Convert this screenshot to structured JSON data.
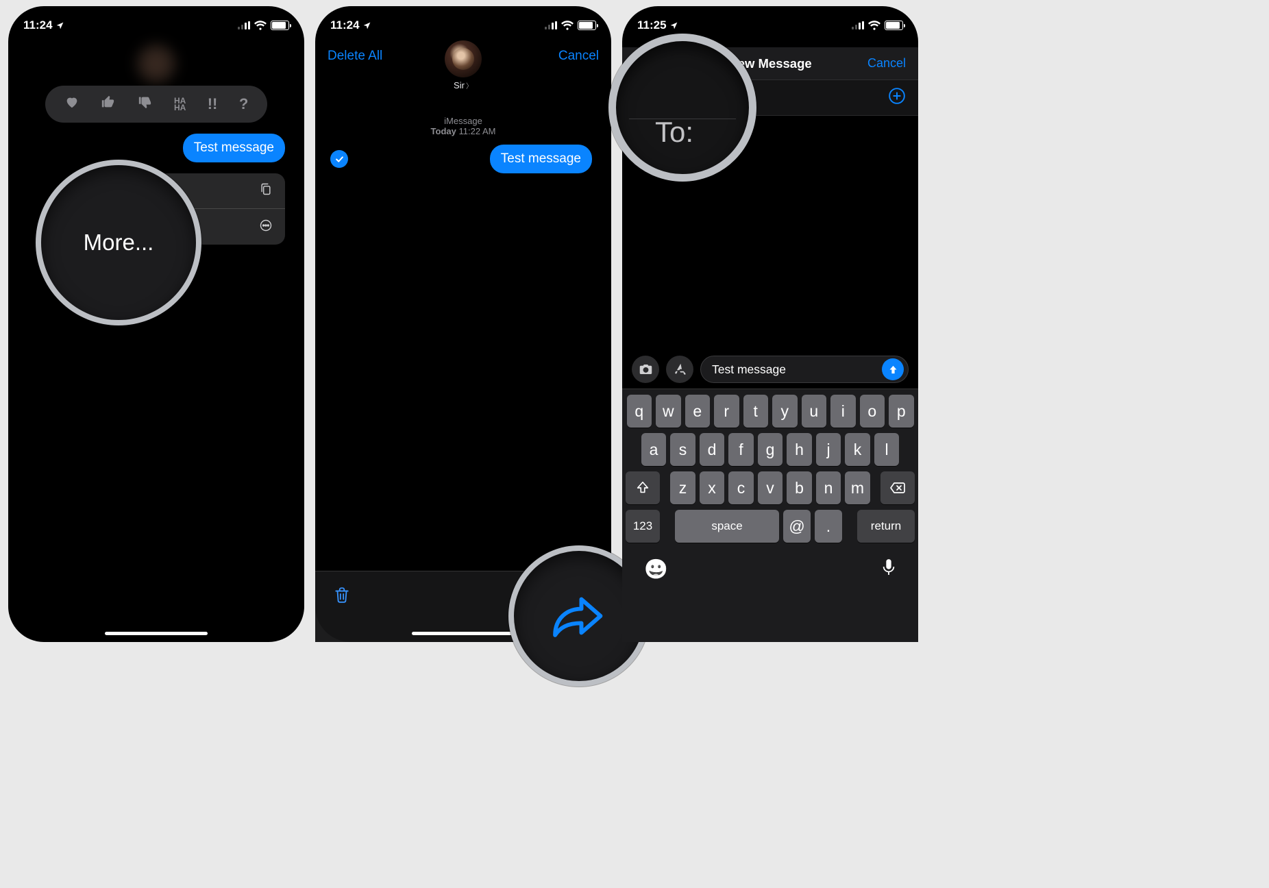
{
  "statusbar": {
    "time1": "11:24",
    "time2": "11:24",
    "time3": "11:25"
  },
  "screen1": {
    "tapbacks": [
      "♥",
      "👍",
      "👎",
      "HA HA",
      "!!",
      "?"
    ],
    "message": "Test message",
    "context_menu": {
      "copy": "Copy",
      "more": "More..."
    },
    "zoom_label": "More..."
  },
  "screen2": {
    "delete_all": "Delete All",
    "cancel": "Cancel",
    "contact_name": "Sir",
    "thread_label": "iMessage",
    "thread_day": "Today",
    "thread_time": "11:22 AM",
    "message": "Test message"
  },
  "screen3": {
    "title": "New Message",
    "cancel": "Cancel",
    "to_label": "To:",
    "zoom_label": "To:",
    "compose_text": "Test message",
    "keyboard": {
      "row1": [
        "q",
        "w",
        "e",
        "r",
        "t",
        "y",
        "u",
        "i",
        "o",
        "p"
      ],
      "row2": [
        "a",
        "s",
        "d",
        "f",
        "g",
        "h",
        "j",
        "k",
        "l"
      ],
      "row3": [
        "z",
        "x",
        "c",
        "v",
        "b",
        "n",
        "m"
      ],
      "num": "123",
      "space": "space",
      "at": "@",
      "dot": ".",
      "ret": "return"
    }
  }
}
